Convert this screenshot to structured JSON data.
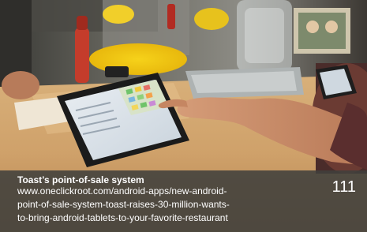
{
  "slide": {
    "title": "Toast’s point-of-sale system",
    "url_lines": [
      "www.oneclickroot.com/android-apps/new-android-",
      "point-of-sale-system-toast-raises-30-million-wants-",
      "to-bring-android-tablets-to-your-favorite-restaurant"
    ],
    "page_number": "111"
  },
  "photo": {
    "subject": "tablet-pos-on-restaurant-counter",
    "colors": {
      "caption_bg": "#40403c",
      "caption_text": "#ffffff"
    }
  }
}
